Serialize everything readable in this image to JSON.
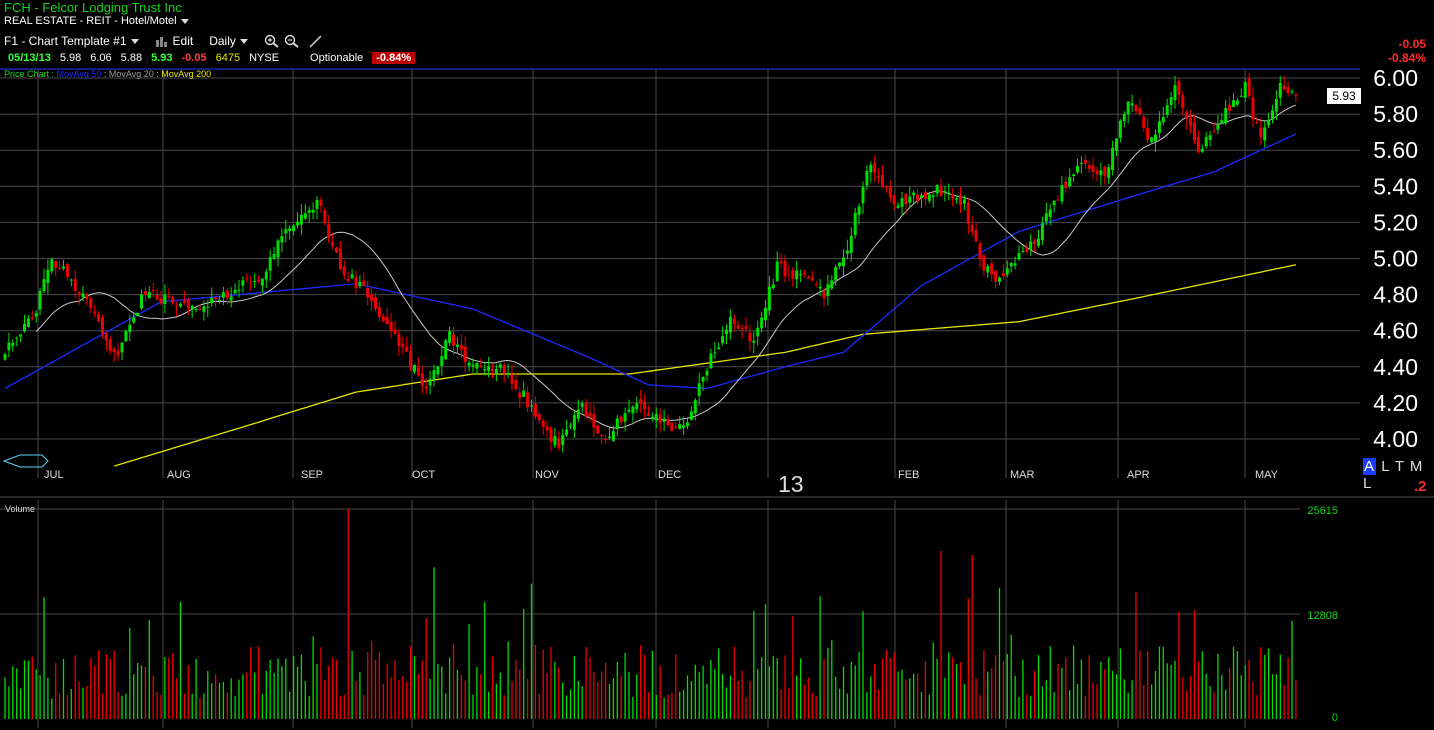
{
  "header": {
    "title": "FCH - Felcor Lodging Trust Inc",
    "sector": "REAL ESTATE - REIT - Hotel/Motel",
    "template": "F1 - Chart Template #1",
    "edit_label": "Edit",
    "period": "Daily"
  },
  "quote": {
    "date": "05/13/13",
    "open": "5.98",
    "high": "6.06",
    "low": "5.88",
    "last": "5.93",
    "change": "-0.05",
    "volume": "6475",
    "exchange": "NYSE",
    "optionable": "Optionable",
    "pct_change": "-0.84%"
  },
  "corner": {
    "change": "-0.05",
    "pct": "-0.84%"
  },
  "legend": {
    "price_chart": "Price Chart",
    "ma50": "MovAvg 50",
    "ma20": "MovAvg 20",
    "ma200": "MovAvg 200"
  },
  "colors": {
    "up": "#00dd00",
    "down": "#ee0000",
    "ma50": "#1a2bff",
    "ma20": "#c8c8c8",
    "ma200": "#e6e600",
    "grid": "#4a4a4a",
    "text_green": "#19d219"
  },
  "range_buttons": {
    "a": "A",
    "rest": "L T M L"
  },
  "side_marker": ".2",
  "chart_data": {
    "type": "candlestick",
    "price_axis": {
      "ticks": [
        "6.00",
        "5.80",
        "5.60",
        "5.40",
        "5.20",
        "5.00",
        "4.80",
        "4.60",
        "4.40",
        "4.20",
        "4.00"
      ],
      "ylim": [
        3.88,
        6.08
      ]
    },
    "last_price_label": "5.93",
    "months": [
      "JUL",
      "AUG",
      "SEP",
      "OCT",
      "NOV",
      "DEC",
      "13",
      "FEB",
      "MAR",
      "APR",
      "MAY"
    ],
    "volume_panel": {
      "label": "Volume",
      "ticks": [
        "25615",
        "12808",
        "0"
      ],
      "ylim": [
        0,
        25615
      ]
    },
    "anchors": [
      {
        "i": 0,
        "c": 4.5
      },
      {
        "i": 8,
        "c": 4.72
      },
      {
        "i": 12,
        "c": 5.0
      },
      {
        "i": 20,
        "c": 4.8
      },
      {
        "i": 28,
        "c": 4.45
      },
      {
        "i": 36,
        "c": 4.82
      },
      {
        "i": 46,
        "c": 4.72
      },
      {
        "i": 55,
        "c": 4.78
      },
      {
        "i": 66,
        "c": 4.9
      },
      {
        "i": 72,
        "c": 5.15
      },
      {
        "i": 80,
        "c": 5.32
      },
      {
        "i": 86,
        "c": 4.95
      },
      {
        "i": 94,
        "c": 4.78
      },
      {
        "i": 102,
        "c": 4.5
      },
      {
        "i": 108,
        "c": 4.28
      },
      {
        "i": 114,
        "c": 4.58
      },
      {
        "i": 120,
        "c": 4.4
      },
      {
        "i": 127,
        "c": 4.4
      },
      {
        "i": 136,
        "c": 4.15
      },
      {
        "i": 142,
        "c": 3.95
      },
      {
        "i": 148,
        "c": 4.18
      },
      {
        "i": 154,
        "c": 4.0
      },
      {
        "i": 162,
        "c": 4.22
      },
      {
        "i": 168,
        "c": 4.1
      },
      {
        "i": 174,
        "c": 4.05
      },
      {
        "i": 180,
        "c": 4.4
      },
      {
        "i": 186,
        "c": 4.65
      },
      {
        "i": 192,
        "c": 4.55
      },
      {
        "i": 198,
        "c": 4.95
      },
      {
        "i": 204,
        "c": 4.9
      },
      {
        "i": 210,
        "c": 4.8
      },
      {
        "i": 215,
        "c": 5.0
      },
      {
        "i": 222,
        "c": 5.55
      },
      {
        "i": 228,
        "c": 5.3
      },
      {
        "i": 234,
        "c": 5.35
      },
      {
        "i": 240,
        "c": 5.38
      },
      {
        "i": 246,
        "c": 5.3
      },
      {
        "i": 250,
        "c": 5.0
      },
      {
        "i": 254,
        "c": 4.85
      },
      {
        "i": 258,
        "c": 4.95
      },
      {
        "i": 264,
        "c": 5.1
      },
      {
        "i": 270,
        "c": 5.35
      },
      {
        "i": 276,
        "c": 5.55
      },
      {
        "i": 282,
        "c": 5.45
      },
      {
        "i": 288,
        "c": 5.9
      },
      {
        "i": 294,
        "c": 5.65
      },
      {
        "i": 300,
        "c": 5.95
      },
      {
        "i": 306,
        "c": 5.6
      },
      {
        "i": 312,
        "c": 5.8
      },
      {
        "i": 318,
        "c": 5.95
      },
      {
        "i": 322,
        "c": 5.65
      },
      {
        "i": 327,
        "c": 5.95
      },
      {
        "i": 331,
        "c": 5.93
      }
    ],
    "ma50_anchors": [
      [
        0,
        4.28
      ],
      [
        40,
        4.76
      ],
      [
        90,
        4.86
      ],
      [
        120,
        4.72
      ],
      [
        150,
        4.45
      ],
      [
        165,
        4.3
      ],
      [
        180,
        4.28
      ],
      [
        200,
        4.4
      ],
      [
        215,
        4.48
      ],
      [
        235,
        4.85
      ],
      [
        260,
        5.15
      ],
      [
        290,
        5.35
      ],
      [
        310,
        5.48
      ],
      [
        332,
        5.7
      ]
    ],
    "ma200_anchors": [
      [
        28,
        3.85
      ],
      [
        60,
        4.06
      ],
      [
        90,
        4.26
      ],
      [
        120,
        4.36
      ],
      [
        160,
        4.36
      ],
      [
        200,
        4.48
      ],
      [
        220,
        4.58
      ],
      [
        260,
        4.65
      ],
      [
        290,
        4.78
      ],
      [
        332,
        4.97
      ]
    ],
    "volume_peaks": [
      [
        88,
        25615
      ],
      [
        110,
        18500
      ],
      [
        135,
        16500
      ],
      [
        195,
        14000
      ],
      [
        240,
        20500
      ],
      [
        248,
        20000
      ],
      [
        255,
        16000
      ],
      [
        290,
        15500
      ],
      [
        330,
        12000
      ]
    ]
  }
}
